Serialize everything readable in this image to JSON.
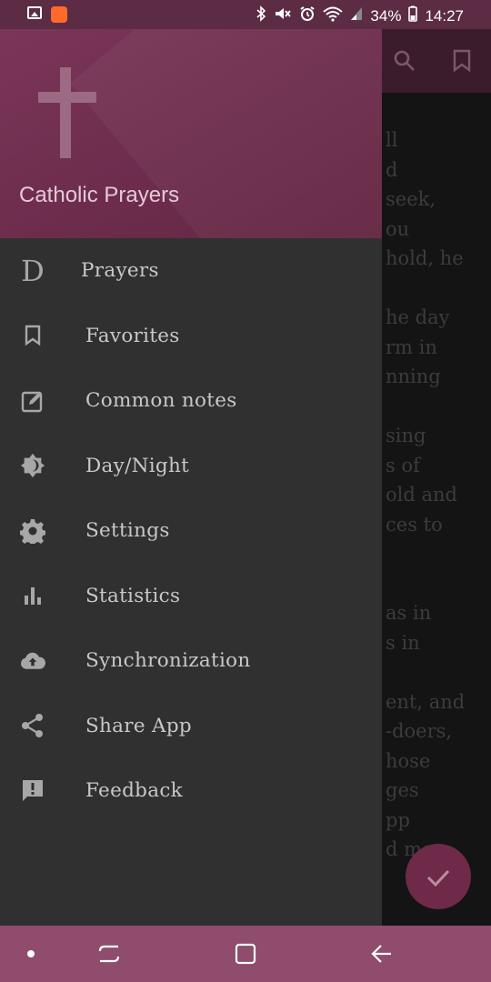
{
  "status_bar": {
    "battery": "34%",
    "time": "14:27",
    "icons": [
      "gallery-icon",
      "app-notification-icon",
      "bluetooth-icon",
      "mute-icon",
      "alarm-icon",
      "wifi-icon",
      "signal-icon",
      "battery-icon"
    ]
  },
  "drawer": {
    "header": {
      "logo_icon": "cross-icon",
      "title": "Catholic Prayers",
      "color": "#6d2c4c"
    },
    "items": [
      {
        "label": "Prayers",
        "icon": "prayers-d-icon",
        "glyph": "D"
      },
      {
        "label": "Favorites",
        "icon": "bookmark-icon"
      },
      {
        "label": "Common notes",
        "icon": "edit-note-icon"
      },
      {
        "label": "Day/Night",
        "icon": "brightness-icon"
      },
      {
        "label": "Settings",
        "icon": "gear-icon"
      },
      {
        "label": "Statistics",
        "icon": "bar-chart-icon"
      },
      {
        "label": "Synchronization",
        "icon": "cloud-upload-icon"
      },
      {
        "label": "Share App",
        "icon": "share-icon"
      },
      {
        "label": "Feedback",
        "icon": "feedback-icon"
      }
    ]
  },
  "background_app": {
    "toolbar_icons": [
      "search-icon",
      "bookmark-icon"
    ],
    "text_lines": [
      "ll",
      "d",
      "seek,",
      "ou",
      "hold, he",
      "",
      "he day",
      "rm in",
      "nning",
      "",
      "sing",
      "s of",
      "old and",
      "ces to",
      "",
      "",
      "as in",
      "s in",
      "",
      "ent, and",
      "-doers,",
      "hose",
      "ges",
      "pp",
      "d me,"
    ],
    "fab_icon": "check-icon"
  },
  "nav_bar": {
    "buttons": [
      "dot-button",
      "recents-button",
      "home-button",
      "back-button"
    ],
    "color": "#8f4c6c"
  }
}
